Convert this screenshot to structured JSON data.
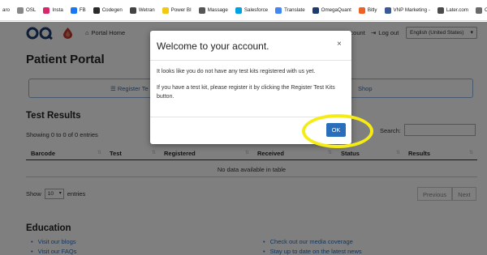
{
  "bookmarks": [
    {
      "label": "aro",
      "icon": "bookmark-icon",
      "color": "#ffffff"
    },
    {
      "label": "OSL",
      "icon": "osl-icon",
      "color": "#888888"
    },
    {
      "label": "Insta",
      "icon": "instagram-icon",
      "color": "#d6296b"
    },
    {
      "label": "FB",
      "icon": "facebook-icon",
      "color": "#1877f2"
    },
    {
      "label": "Codegen",
      "icon": "codegen-icon",
      "color": "#2b2b2b"
    },
    {
      "label": "Wetran",
      "icon": "wetran-icon",
      "color": "#444444"
    },
    {
      "label": "Power BI",
      "icon": "powerbi-icon",
      "color": "#f2c811"
    },
    {
      "label": "Massage",
      "icon": "massage-icon",
      "color": "#555555"
    },
    {
      "label": "Salesforce",
      "icon": "salesforce-icon",
      "color": "#00a1e0"
    },
    {
      "label": "Translate",
      "icon": "translate-icon",
      "color": "#4285f4"
    },
    {
      "label": "OmegaQuant",
      "icon": "omegaquant-icon",
      "color": "#1d3c6e"
    },
    {
      "label": "Bitly",
      "icon": "bitly-icon",
      "color": "#ee6123"
    },
    {
      "label": "VNP Marketing -",
      "icon": "vnp-icon",
      "color": "#3b5998"
    },
    {
      "label": "Later.com",
      "icon": "later-icon",
      "color": "#4b4b4b"
    },
    {
      "label": "Cha",
      "icon": "chat-icon",
      "color": "#6a6a6a"
    }
  ],
  "navbar": {
    "home_label": "Portal Home",
    "account_label": "Account",
    "logout_label": "Log out",
    "language": "English (United States)"
  },
  "page": {
    "title": "Patient Portal",
    "register_tab": "Register Te",
    "shop_tab": "Shop"
  },
  "results": {
    "heading": "Test Results",
    "showing": "Showing 0 to 0 of 0 entries",
    "search_label": "Search:",
    "columns": [
      "Barcode",
      "Test",
      "Registered",
      "Received",
      "Status",
      "Results"
    ],
    "empty_text": "No data available in table",
    "show_label": "Show",
    "entries_value": "10",
    "entries_label": "entries",
    "previous_label": "Previous",
    "next_label": "Next"
  },
  "education": {
    "heading": "Education",
    "links_left": [
      "Visit our blogs",
      "Visit our FAQs"
    ],
    "links_right": [
      "Check out our media coverage",
      "Stay up to date on the latest news"
    ]
  },
  "modal": {
    "title": "Welcome to your account.",
    "close": "×",
    "paragraph1": "It looks like you do not have any test kits registered with us yet.",
    "paragraph2": "If you have a test kit, please register it by clicking the Register Test Kits button.",
    "ok_label": "OK"
  },
  "colors": {
    "primary": "#2a6ebb",
    "highlight": "#f5ec16",
    "logo": "#1d3c6e",
    "drop": "#c0392b"
  }
}
